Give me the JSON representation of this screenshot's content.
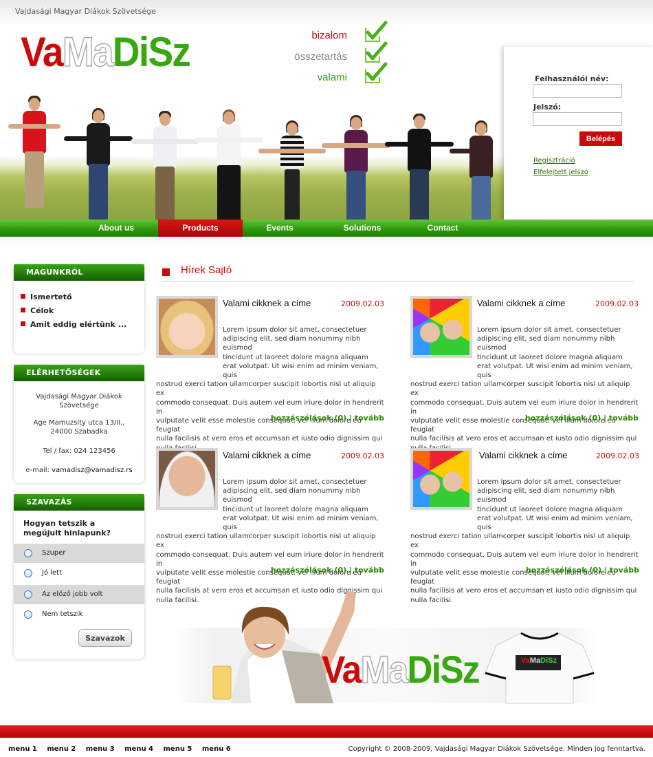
{
  "header": {
    "org_name": "Vajdasági Magyar Diákok Szövetsége",
    "logo": {
      "part1": "Va",
      "part2": "Ma",
      "part3": "DiSz"
    },
    "slogans": [
      "bizalom",
      "összetartás",
      "valami"
    ]
  },
  "login": {
    "username_label": "Felhasználói név:",
    "username_value": "",
    "password_label": "Jelszó:",
    "password_value": "",
    "submit_label": "Belépés",
    "register_link": "Regisztráció",
    "forgot_link": "Elfelejtett jelszó"
  },
  "nav": {
    "items": [
      {
        "label": "About us",
        "active": false
      },
      {
        "label": "Products",
        "active": true
      },
      {
        "label": "Events",
        "active": false
      },
      {
        "label": "Solutions",
        "active": false
      },
      {
        "label": "Contact",
        "active": false
      }
    ]
  },
  "sidebar": {
    "about": {
      "title": "MAGUNKRÓL",
      "items": [
        "Ismertető",
        "Célok",
        "Amit eddig elértünk ..."
      ]
    },
    "contact": {
      "title": "ELÉRHETŐSÉGEK",
      "org_line1": "Vajdasági Magyar Diákok",
      "org_line2": "Szövetsége",
      "address_line1": "Age Mamuzsity utca 13/II.,",
      "address_line2": "24000 Szabadka",
      "phone": "Tel / fax: 024 123456",
      "email_label": "e-mail:",
      "email_value": "vamadisz@vamadisz.rs"
    },
    "poll": {
      "title": "SZAVAZÁS",
      "question": "Hogyan tetszik a megújult hinlapunk?",
      "options": [
        "Szuper",
        "Jó lett",
        "Az előző jobb volt",
        "Nem tetszik"
      ],
      "submit_label": "Szavazok"
    }
  },
  "main": {
    "section_title": "Hírek Sajtó",
    "articles": [
      {
        "title": "Valami cikknek a címe",
        "date": "2009.02.03",
        "indented": [
          "Lorem ipsum dolor sit amet, consectetuer",
          "adipiscing elit, sed diam nonummy nibh euismod",
          "tincidunt ut laoreet dolore magna aliquam",
          "erat volutpat. Ut wisi enim ad minim veniam, quis"
        ],
        "full": [
          "nostrud exerci tation ullamcorper suscipit lobortis nisl ut aliquip ex",
          "commodo consequat. Duis autem vel eum iriure dolor in hendrerit in",
          "vulputate velit esse molestie consequat, vel illum dolore eu feugiat",
          "nulla facilisis at vero eros et accumsan et iusto odio dignissim qui",
          "nulla facilisi."
        ],
        "comments_link": "hozzászólások (0)",
        "more_link": "tovább"
      },
      {
        "title": "Valami cikknek a címe",
        "date": "2009.02.03",
        "indented": [
          "Lorem ipsum dolor sit amet, consectetuer",
          "adipiscing elit, sed diam nonummy nibh euismod",
          "tincidunt ut laoreet dolore magna aliquam",
          "erat volutpat. Ut wisi enim ad minim veniam, quis"
        ],
        "full": [
          "nostrud exerci tation ullamcorper suscipit lobortis nisl ut aliquip ex",
          "commodo consequat. Duis autem vel eum iriure dolor in hendrerit in",
          "vulputate velit esse molestie consequat, vel illum dolore eu feugiat",
          "nulla facilisis at vero eros et accumsan et iusto odio dignissim qui",
          "nulla facilisi."
        ],
        "comments_link": "hozzászólások (0)",
        "more_link": "tovább"
      },
      {
        "title": "Valami cikknek a címe",
        "date": "2009.02.03",
        "indented": [
          "Lorem ipsum dolor sit amet, consectetuer",
          "adipiscing elit, sed diam nonummy nibh euismod",
          "tincidunt ut laoreet dolore magna aliquam",
          "erat volutpat. Ut wisi enim ad minim veniam, quis"
        ],
        "full": [
          "nostrud exerci tation ullamcorper suscipit lobortis nisl ut aliquip ex",
          "commodo consequat. Duis autem vel eum iriure dolor in hendrerit in",
          "vulputate velit esse molestie consequat, vel illum dolore eu feugiat",
          "nulla facilisis at vero eros et accumsan et iusto odio dignissim qui",
          "nulla facilisi."
        ],
        "comments_link": "hozzászólások (0)",
        "more_link": "tovább"
      },
      {
        "title": "Valami cikknek a címe",
        "date": "2009.02.03",
        "indented": [
          "Lorem ipsum dolor sit amet, consectetuer",
          "adipiscing elit, sed diam nonummy nibh euismod",
          "tincidunt ut laoreet dolore magna aliquam",
          "erat volutpat. Ut wisi enim ad minim veniam, quis"
        ],
        "full": [
          "nostrud exerci tation ullamcorper suscipit lobortis nisl ut aliquip ex",
          "commodo consequat. Duis autem vel eum iriure dolor in hendrerit in",
          "vulputate velit esse molestie consequat, vel illum dolore eu feugiat",
          "nulla facilisis at vero eros et accumsan et iusto odio dignissim qui",
          "nulla facilisi."
        ],
        "comments_link": "hozzászólások (0)",
        "more_link": "tovább"
      }
    ]
  },
  "banner": {
    "logo": {
      "part1": "Va",
      "part2": "Ma",
      "part3": "DiSz"
    },
    "shirt_logo": {
      "part1": "Va",
      "part2": "Ma",
      "part3": "DiSz"
    }
  },
  "footer": {
    "menu": [
      "menu 1",
      "menu 2",
      "menu 3",
      "menu 4",
      "menu 5",
      "menu 6"
    ],
    "copyright": "Copyright © 2008-2009, Vajdasági Magyar Diákok Szövetsége. Minden jog fenntartva."
  },
  "colors": {
    "brand_red": "#cc0a0a",
    "brand_green": "#37a80e",
    "nav_green": "#2f9a0c",
    "link_green": "#2d8a00"
  }
}
